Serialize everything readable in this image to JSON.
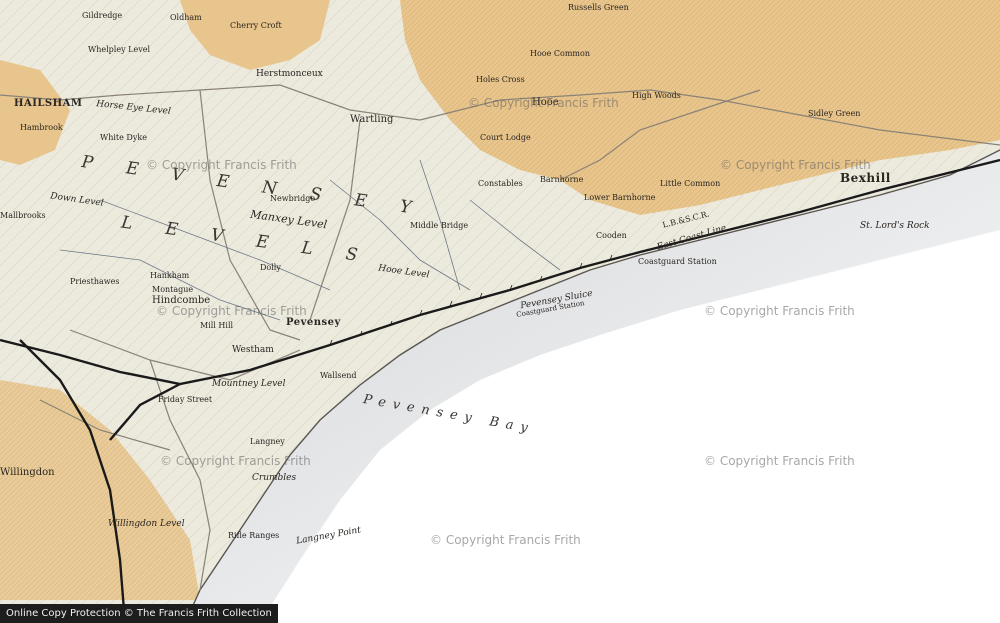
{
  "map": {
    "colors": {
      "sea": "#ffffff",
      "land": "#ece9dd",
      "woodland": "#e8c58c",
      "railway": "#1a1a1a",
      "ink": "#2a2622"
    },
    "regions": [
      {
        "name": "region-pevensey",
        "text": "P E V E N S E Y"
      },
      {
        "name": "region-levels",
        "text": "L E V E L S"
      }
    ],
    "towns": [
      {
        "name": "town-hailsham",
        "text": "HAILSHAM"
      },
      {
        "name": "town-bexhill",
        "text": "Bexhill"
      },
      {
        "name": "town-pevensey",
        "text": "Pevensey"
      }
    ],
    "water": [
      {
        "name": "water-pevensey-bay",
        "text": "Pevensey Bay"
      }
    ],
    "places": [
      {
        "name": "place-gildredge",
        "text": "Gildredge"
      },
      {
        "name": "place-oldham",
        "text": "Oldham"
      },
      {
        "name": "place-cherry-croft",
        "text": "Cherry Croft"
      },
      {
        "name": "place-whelpley-level",
        "text": "Whelpley Level"
      },
      {
        "name": "place-herstmonceux",
        "text": "Herstmonceux"
      },
      {
        "name": "place-horse-eye-level",
        "text": "Horse Eye Level"
      },
      {
        "name": "place-white-dyke",
        "text": "White Dyke"
      },
      {
        "name": "place-hambrook",
        "text": "Hambrook"
      },
      {
        "name": "place-down-level",
        "text": "Down Level"
      },
      {
        "name": "place-mallbrooks",
        "text": "Mallbrooks"
      },
      {
        "name": "place-wartling",
        "text": "Wartling"
      },
      {
        "name": "place-newbridge",
        "text": "Newbridge"
      },
      {
        "name": "place-manxey-level",
        "text": "Manxey Level"
      },
      {
        "name": "place-middle-bridge",
        "text": "Middle Bridge"
      },
      {
        "name": "place-hooe-level",
        "text": "Hooe Level"
      },
      {
        "name": "place-hooe",
        "text": "Hooe"
      },
      {
        "name": "place-hooe-common",
        "text": "Hooe Common"
      },
      {
        "name": "place-russells-green",
        "text": "Russells Green"
      },
      {
        "name": "place-holes-cross",
        "text": "Holes Cross"
      },
      {
        "name": "place-court-lodge",
        "text": "Court Lodge"
      },
      {
        "name": "place-constables",
        "text": "Constables"
      },
      {
        "name": "place-barnhorne",
        "text": "Barnhorne"
      },
      {
        "name": "place-lower-barnhorne",
        "text": "Lower Barnhorne"
      },
      {
        "name": "place-cooden",
        "text": "Cooden"
      },
      {
        "name": "place-coastguard-station-cooden",
        "text": "Coastguard Station"
      },
      {
        "name": "place-little-common",
        "text": "Little Common"
      },
      {
        "name": "place-high-woods",
        "text": "High Woods"
      },
      {
        "name": "place-sidley-green",
        "text": "Sidley Green"
      },
      {
        "name": "place-pevensey-sluice",
        "text": "Pevensey Sluice"
      },
      {
        "name": "place-coastguard-station-sluice",
        "text": "Coastguard Station"
      },
      {
        "name": "place-dolly",
        "text": "Dolly"
      },
      {
        "name": "place-priesthawes",
        "text": "Priesthawes"
      },
      {
        "name": "place-hankham",
        "text": "Hankham"
      },
      {
        "name": "place-montague",
        "text": "Montague"
      },
      {
        "name": "place-hindcombe",
        "text": "Hindcombe"
      },
      {
        "name": "place-mill-hill",
        "text": "Mill Hill"
      },
      {
        "name": "place-westham",
        "text": "Westham"
      },
      {
        "name": "place-wallsend",
        "text": "Wallsend"
      },
      {
        "name": "place-mountney-level",
        "text": "Mountney Level"
      },
      {
        "name": "place-friday-street",
        "text": "Friday Street"
      },
      {
        "name": "place-langney",
        "text": "Langney"
      },
      {
        "name": "place-crumbles",
        "text": "Crumbles"
      },
      {
        "name": "place-willingdon",
        "text": "Willingdon"
      },
      {
        "name": "place-willingdon-level",
        "text": "Willingdon Level"
      },
      {
        "name": "place-rifle-ranges",
        "text": "Rifle Ranges"
      },
      {
        "name": "place-langney-point",
        "text": "Langney Point"
      },
      {
        "name": "place-east-coast-line",
        "text": "East Coast Line"
      },
      {
        "name": "place-lbscr",
        "text": "L.B.&S.C.R."
      },
      {
        "name": "place-st-leonards-rock",
        "text": "St. Lord's Rock"
      }
    ],
    "watermarks": [
      "© Copyright Francis Frith",
      "© Copyright Francis Frith",
      "© Copyright Francis Frith",
      "© Copyright Francis Frith",
      "© Copyright Francis Frith",
      "© Copyright Francis Frith",
      "© Copyright Francis Frith"
    ],
    "credit": "Online Copy Protection © The Francis Frith Collection"
  }
}
